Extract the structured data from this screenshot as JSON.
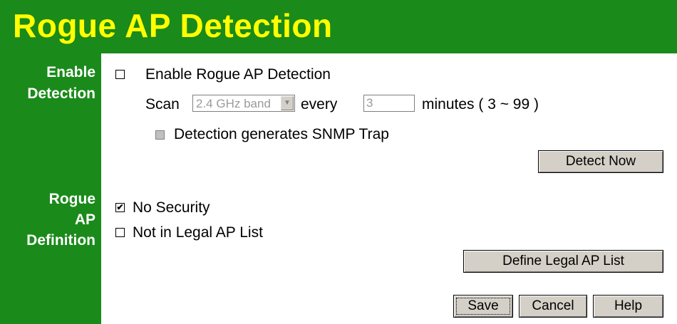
{
  "header": {
    "title": "Rogue AP Detection"
  },
  "sections": {
    "detection_label_line1": "Enable",
    "detection_label_line2": "Detection",
    "definition_label_line1": "Rogue",
    "definition_label_line2": "AP",
    "definition_label_line3": "Definition"
  },
  "detection": {
    "enable_checkbox_label": "Enable Rogue AP Detection",
    "enable_checked": false,
    "scan_label": "Scan",
    "band_selected": "2.4 GHz band",
    "every_label": "every",
    "interval_value": "3",
    "minutes_label": "minutes ( 3 ~ 99 )",
    "snmp_trap_label": "Detection generates SNMP Trap",
    "snmp_trap_checked": false,
    "detect_now_button": "Detect Now"
  },
  "definition": {
    "no_security_label": "No Security",
    "no_security_checked": true,
    "not_in_legal_label": "Not in Legal AP List",
    "not_in_legal_checked": false,
    "define_legal_button": "Define Legal AP List"
  },
  "footer": {
    "save_button": "Save",
    "cancel_button": "Cancel",
    "help_button": "Help"
  },
  "colors": {
    "green": "#1a8a1a",
    "title_yellow": "#ffff00",
    "button_face": "#d4d0c8"
  }
}
